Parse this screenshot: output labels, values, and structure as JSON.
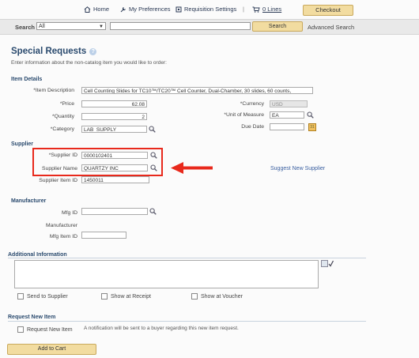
{
  "top_links": {
    "home": "Home",
    "preferences": "My Preferences",
    "req_settings": "Requisition Settings",
    "separator": "|",
    "lines": "0 Lines",
    "checkout": "Checkout"
  },
  "search": {
    "label": "Search",
    "scope": "All",
    "value": "",
    "button": "Search",
    "advanced": "Advanced Search"
  },
  "page": {
    "title": "Special Requests",
    "instructions": "Enter information about the non-catalog item you would like to order:"
  },
  "item_details": {
    "heading": "Item Details",
    "description_label": "*Item Description",
    "description": "Cell Counting Slides for TC10™/TC20™ Cell Counter, Dual-Chamber, 30 slides, 60 counts,",
    "price_label": "*Price",
    "price": "62.08",
    "currency_label": "*Currency",
    "currency": "USD",
    "quantity_label": "*Quantity",
    "quantity": "2",
    "uom_label": "*Unit of Measure",
    "uom": "EA",
    "category_label": "*Category",
    "category": "LAB_SUPPLY",
    "due_label": "Due Date",
    "due": "",
    "calendar": "31"
  },
  "supplier": {
    "heading": "Supplier",
    "id_label": "*Supplier ID",
    "id": "0000102401",
    "name_label": "Supplier Name",
    "name": "QUARTZY INC",
    "item_id_label": "Supplier Item ID",
    "item_id": "1450011",
    "suggest": "Suggest New Supplier"
  },
  "manufacturer": {
    "heading": "Manufacturer",
    "mfg_id_label": "Mfg ID",
    "mfg_id": "",
    "name_label": "Manufacturer",
    "item_id_label": "Mfg Item ID",
    "item_id": ""
  },
  "additional": {
    "heading": "Additional Information",
    "text": "",
    "send_supplier": "Send to Supplier",
    "show_receipt": "Show at Receipt",
    "show_voucher": "Show at Voucher"
  },
  "request_new": {
    "heading": "Request New Item",
    "checkbox": "Request New Item",
    "note": "A notification will be sent to a buyer regarding this new item request."
  },
  "add_to_cart": "Add to Cart",
  "colors": {
    "highlight": "#e8291c",
    "heading": "#2a4a6e",
    "button": "#f2dca0"
  }
}
